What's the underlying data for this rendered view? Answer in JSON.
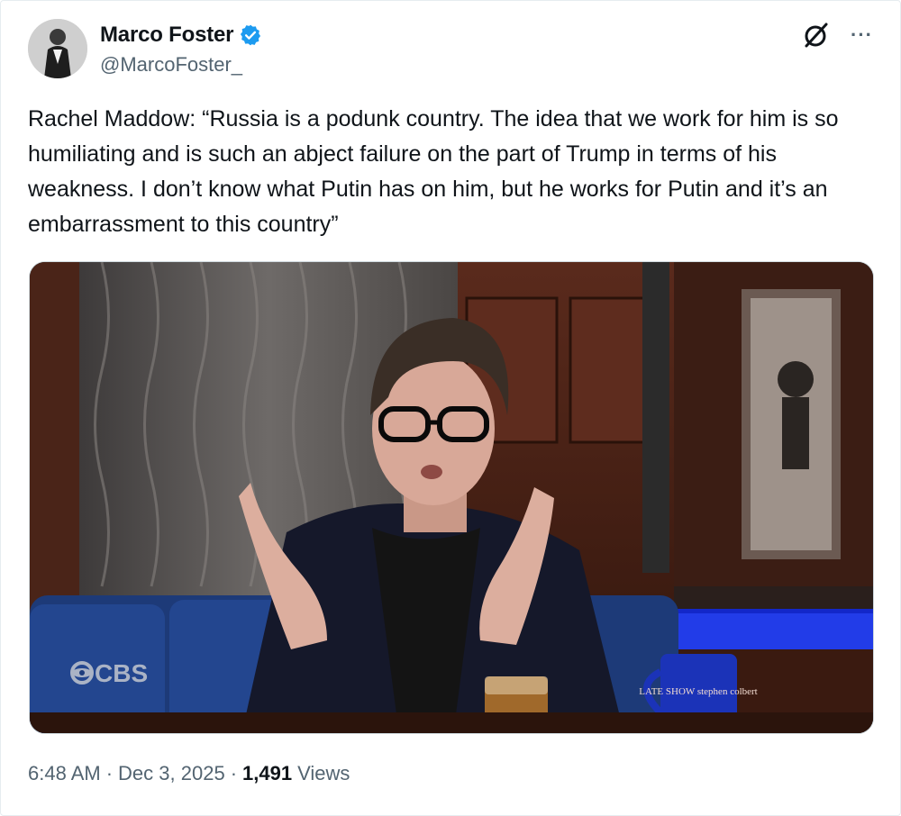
{
  "author": {
    "display_name": "Marco Foster",
    "handle": "@MarcoFoster_",
    "avatar_icon": "avatar-photo",
    "verified": true
  },
  "tweet": {
    "text": "Rachel Maddow: “Russia is a podunk country. The idea that we work for him is so humiliating and is such an abject failure on the part of Trump in terms of his weakness. I don’t know what Putin has on him, but he works for Putin and it’s an embarrassment to this country”"
  },
  "media": {
    "watermark": "CBS",
    "mug_text": "LATE SHOW stephen colbert"
  },
  "meta": {
    "time": "6:48 AM",
    "separator": "·",
    "date": "Dec 3, 2025",
    "views_count": "1,491",
    "views_label": "Views"
  },
  "colors": {
    "verified_blue": "#1d9bf0",
    "secondary_text": "#536471",
    "primary_text": "#0f1419"
  }
}
